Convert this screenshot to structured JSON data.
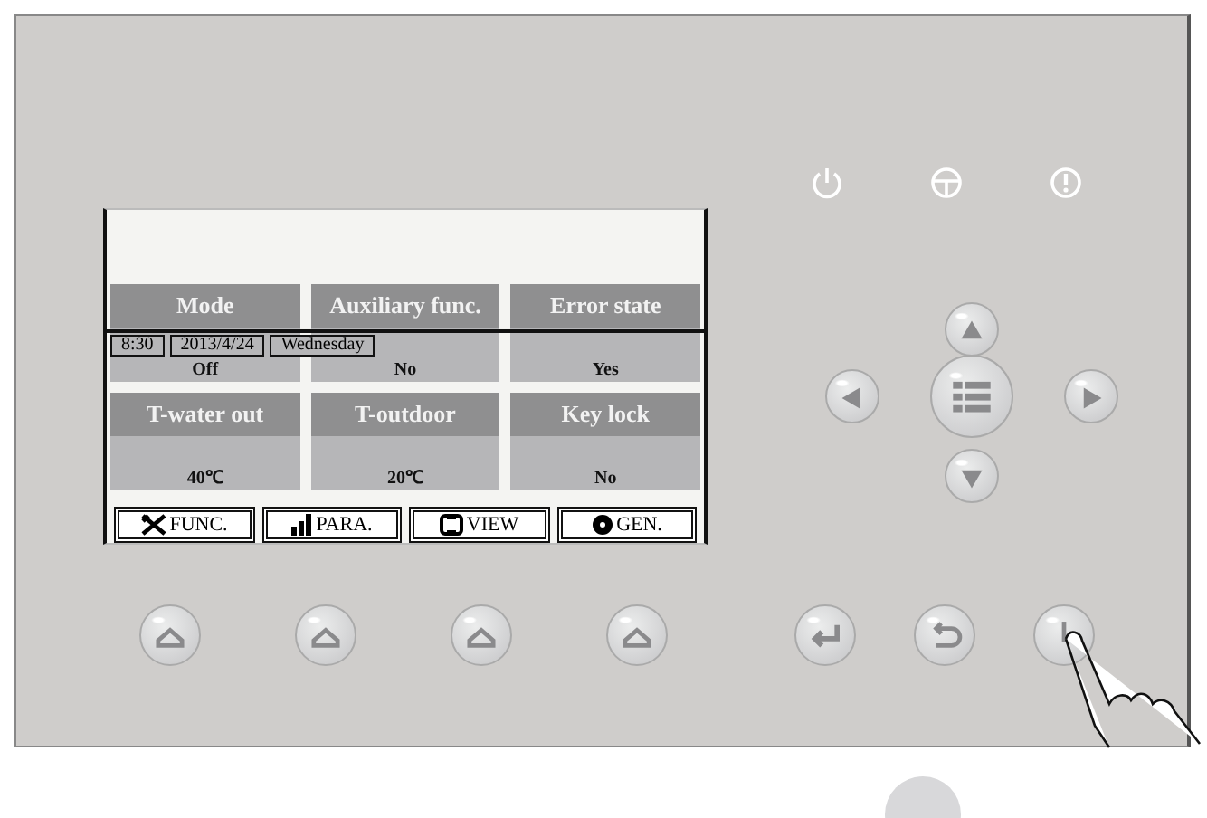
{
  "screen": {
    "status": {
      "time": "8:30",
      "date": "2013/4/24",
      "day": "Wednesday"
    },
    "tiles": [
      {
        "label": "Mode",
        "value": "Off"
      },
      {
        "label": "Auxiliary func.",
        "value": "No"
      },
      {
        "label": "Error state",
        "value": "Yes"
      },
      {
        "label": "T-water out",
        "value": "40℃"
      },
      {
        "label": "T-outdoor",
        "value": "20℃"
      },
      {
        "label": "Key lock",
        "value": "No"
      }
    ],
    "softkeys": [
      {
        "kind": "func",
        "label": "FUNC."
      },
      {
        "kind": "para",
        "label": "PARA."
      },
      {
        "kind": "view",
        "label": "VIEW"
      },
      {
        "kind": "gen",
        "label": "GEN."
      }
    ]
  }
}
